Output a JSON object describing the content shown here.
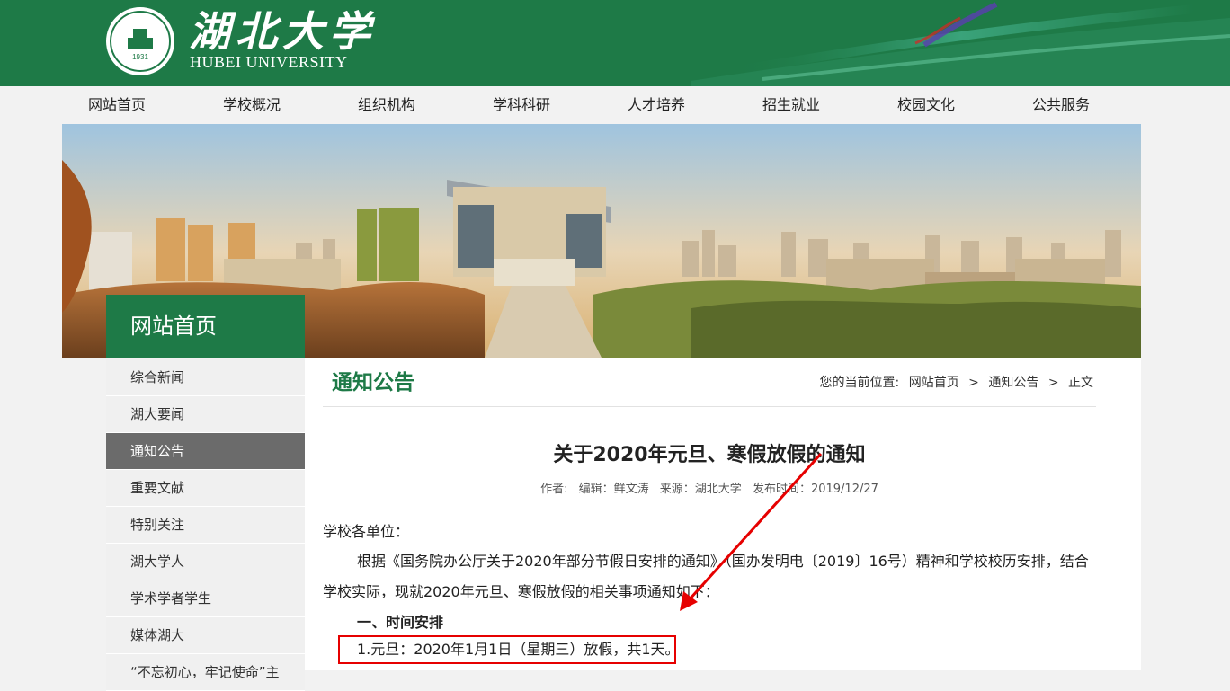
{
  "header": {
    "logo_cn": "湖北大学",
    "logo_en": "HUBEI UNIVERSITY",
    "seal_year": "1931"
  },
  "nav": {
    "items": [
      "网站首页",
      "学校概况",
      "组织机构",
      "学科科研",
      "人才培养",
      "招生就业",
      "校园文化",
      "公共服务"
    ]
  },
  "section_tab": "网站首页",
  "sidebar": {
    "items": [
      {
        "label": "综合新闻",
        "active": false
      },
      {
        "label": "湖大要闻",
        "active": false
      },
      {
        "label": "通知公告",
        "active": true
      },
      {
        "label": "重要文献",
        "active": false
      },
      {
        "label": "特别关注",
        "active": false
      },
      {
        "label": "湖大学人",
        "active": false
      },
      {
        "label": "学术学者学生",
        "active": false
      },
      {
        "label": "媒体湖大",
        "active": false
      },
      {
        "label": "“不忘初心，牢记使命”主",
        "active": false
      }
    ]
  },
  "main": {
    "title": "通知公告",
    "breadcrumb": {
      "prefix": "您的当前位置:",
      "items": [
        "网站首页",
        "通知公告",
        "正文"
      ],
      "sep": ">"
    }
  },
  "article": {
    "title": "关于2020年元旦、寒假放假的通知",
    "meta": {
      "author": "作者:",
      "editor": "编辑：鲜文涛",
      "source": "来源：湖北大学",
      "date": "发布时间：2019/12/27"
    },
    "salutation": "学校各单位：",
    "intro_line1": "根据《国务院办公厅关于2020年部分节假日安排的通知》（国办发明电〔2019〕16号）精神和学校校历安排，结合",
    "intro_line2": "学校实际，现就2020年元旦、寒假放假的相关事项通知如下：",
    "section1": "一、时间安排",
    "item1": "1.元旦：2020年1月1日（星期三）放假，共1天。"
  },
  "colors": {
    "brand_green": "#1e7a47",
    "sidebar_active": "#6b6b6b",
    "annotation_red": "#e60000"
  }
}
